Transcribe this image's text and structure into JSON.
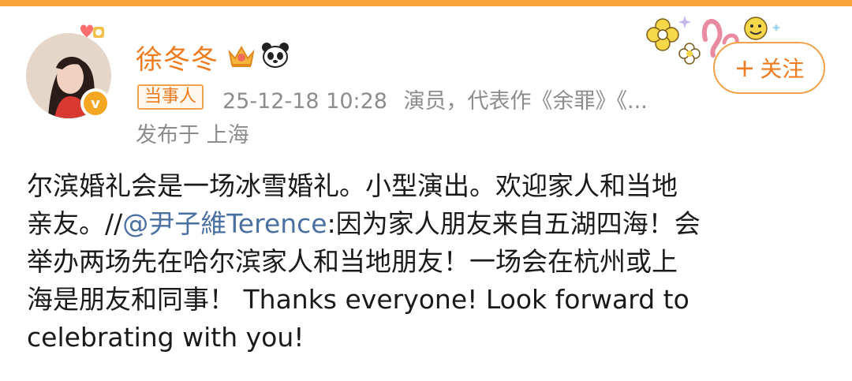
{
  "header": {
    "username": "徐冬冬",
    "tag": "当事人",
    "timestamp": "25-12-18 10:28",
    "bio_snippet": "演员，代表作《余罪》《...",
    "location": "发布于 上海",
    "follow_plus": "+",
    "follow_label": "关注",
    "verified_mark": "v",
    "icons": [
      "crown-icon",
      "panda-icon",
      "verified-badge-icon",
      "flower-sticker-icon",
      "smiley-icon"
    ]
  },
  "post": {
    "line1": "尔滨婚礼会是一场冰雪婚礼。小型演出。欢迎家人和当地",
    "line2_prefix": "亲友。//",
    "mention": "@尹子維Terence",
    "line2_suffix": ":因为家人朋友来自五湖四海！会",
    "line3": "举办两场先在哈尔滨家人和当地朋友！一场会在杭州或上",
    "line4": "海是朋友和同事！ Thanks everyone!  Look forward to",
    "line5": "celebrating with you!"
  },
  "colors": {
    "accent": "#ef7b1f",
    "top_strip": "#f7a53b",
    "meta_gray": "#8c8c8c",
    "mention_blue": "#4a6fa1"
  }
}
